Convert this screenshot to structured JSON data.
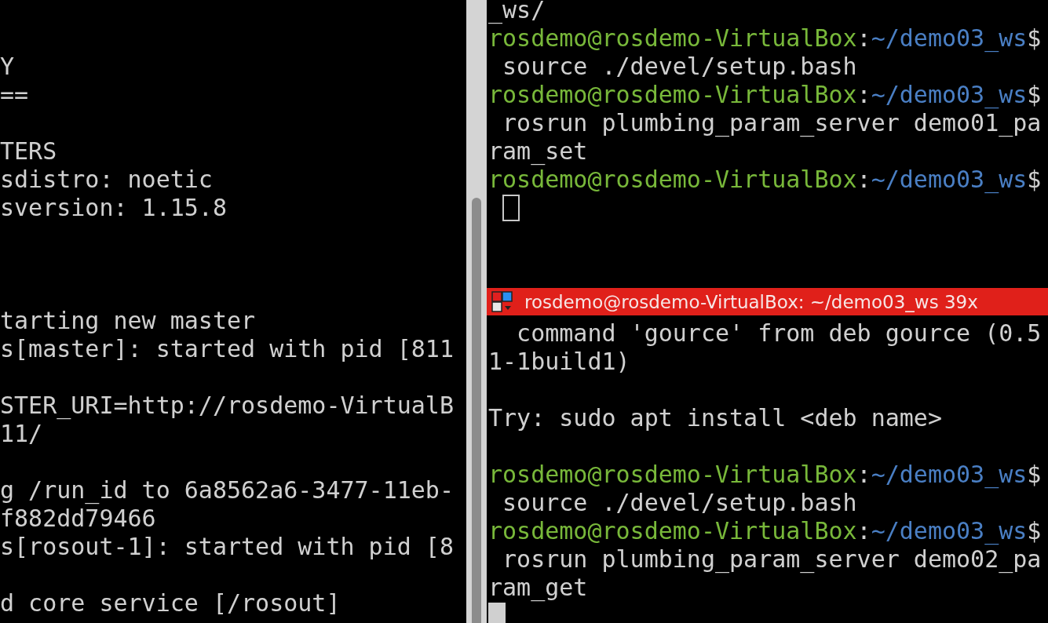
{
  "left_terminal": {
    "lines": [
      {
        "kind": "blank"
      },
      {
        "kind": "blank"
      },
      {
        "kind": "text",
        "text": "Y"
      },
      {
        "kind": "text",
        "text": "=="
      },
      {
        "kind": "blank"
      },
      {
        "kind": "text",
        "text": "TERS"
      },
      {
        "kind": "text",
        "text": "sdistro: noetic"
      },
      {
        "kind": "text",
        "text": "sversion: 1.15.8"
      },
      {
        "kind": "blank"
      },
      {
        "kind": "blank"
      },
      {
        "kind": "blank"
      },
      {
        "kind": "text",
        "text": "tarting new master"
      },
      {
        "kind": "text",
        "text": "s[master]: started with pid [811"
      },
      {
        "kind": "blank"
      },
      {
        "kind": "text",
        "text": "STER_URI=http://rosdemo-VirtualB"
      },
      {
        "kind": "text",
        "text": "11/"
      },
      {
        "kind": "blank"
      },
      {
        "kind": "text",
        "text": "g /run_id to 6a8562a6-3477-11eb-"
      },
      {
        "kind": "text",
        "text": "f882dd79466"
      },
      {
        "kind": "text",
        "text": "s[rosout-1]: started with pid [8"
      },
      {
        "kind": "blank"
      },
      {
        "kind": "text",
        "text": "d core service [/rosout]"
      }
    ]
  },
  "top_right_terminal": {
    "focused": false,
    "lines": [
      {
        "kind": "text",
        "text": "_ws/"
      },
      {
        "kind": "prompt",
        "user": "rosdemo@rosdemo-VirtualBox",
        "sep": ":",
        "path": "~/demo03_ws",
        "end": "$"
      },
      {
        "kind": "text",
        "text": " source ./devel/setup.bash"
      },
      {
        "kind": "prompt",
        "user": "rosdemo@rosdemo-VirtualBox",
        "sep": ":",
        "path": "~/demo03_ws",
        "end": "$"
      },
      {
        "kind": "text",
        "text": " rosrun plumbing_param_server demo01_pa"
      },
      {
        "kind": "text",
        "text": "ram_set"
      },
      {
        "kind": "prompt",
        "user": "rosdemo@rosdemo-VirtualBox",
        "sep": ":",
        "path": "~/demo03_ws",
        "end": "$"
      },
      {
        "kind": "indented_cursor"
      }
    ]
  },
  "bottom_right_terminal": {
    "title": "rosdemo@rosdemo-VirtualBox: ~/demo03_ws 39x",
    "focused": true,
    "lines": [
      {
        "kind": "text",
        "text": "  command 'gource' from deb gource (0.5"
      },
      {
        "kind": "text",
        "text": "1-1build1)"
      },
      {
        "kind": "blank"
      },
      {
        "kind": "text",
        "text": "Try: sudo apt install <deb name>"
      },
      {
        "kind": "blank"
      },
      {
        "kind": "prompt",
        "user": "rosdemo@rosdemo-VirtualBox",
        "sep": ":",
        "path": "~/demo03_ws",
        "end": "$"
      },
      {
        "kind": "text",
        "text": " source ./devel/setup.bash"
      },
      {
        "kind": "prompt",
        "user": "rosdemo@rosdemo-VirtualBox",
        "sep": ":",
        "path": "~/demo03_ws",
        "end": "$"
      },
      {
        "kind": "text",
        "text": " rosrun plumbing_param_server demo02_pa"
      },
      {
        "kind": "text",
        "text": "ram_get"
      },
      {
        "kind": "cursor"
      }
    ]
  }
}
